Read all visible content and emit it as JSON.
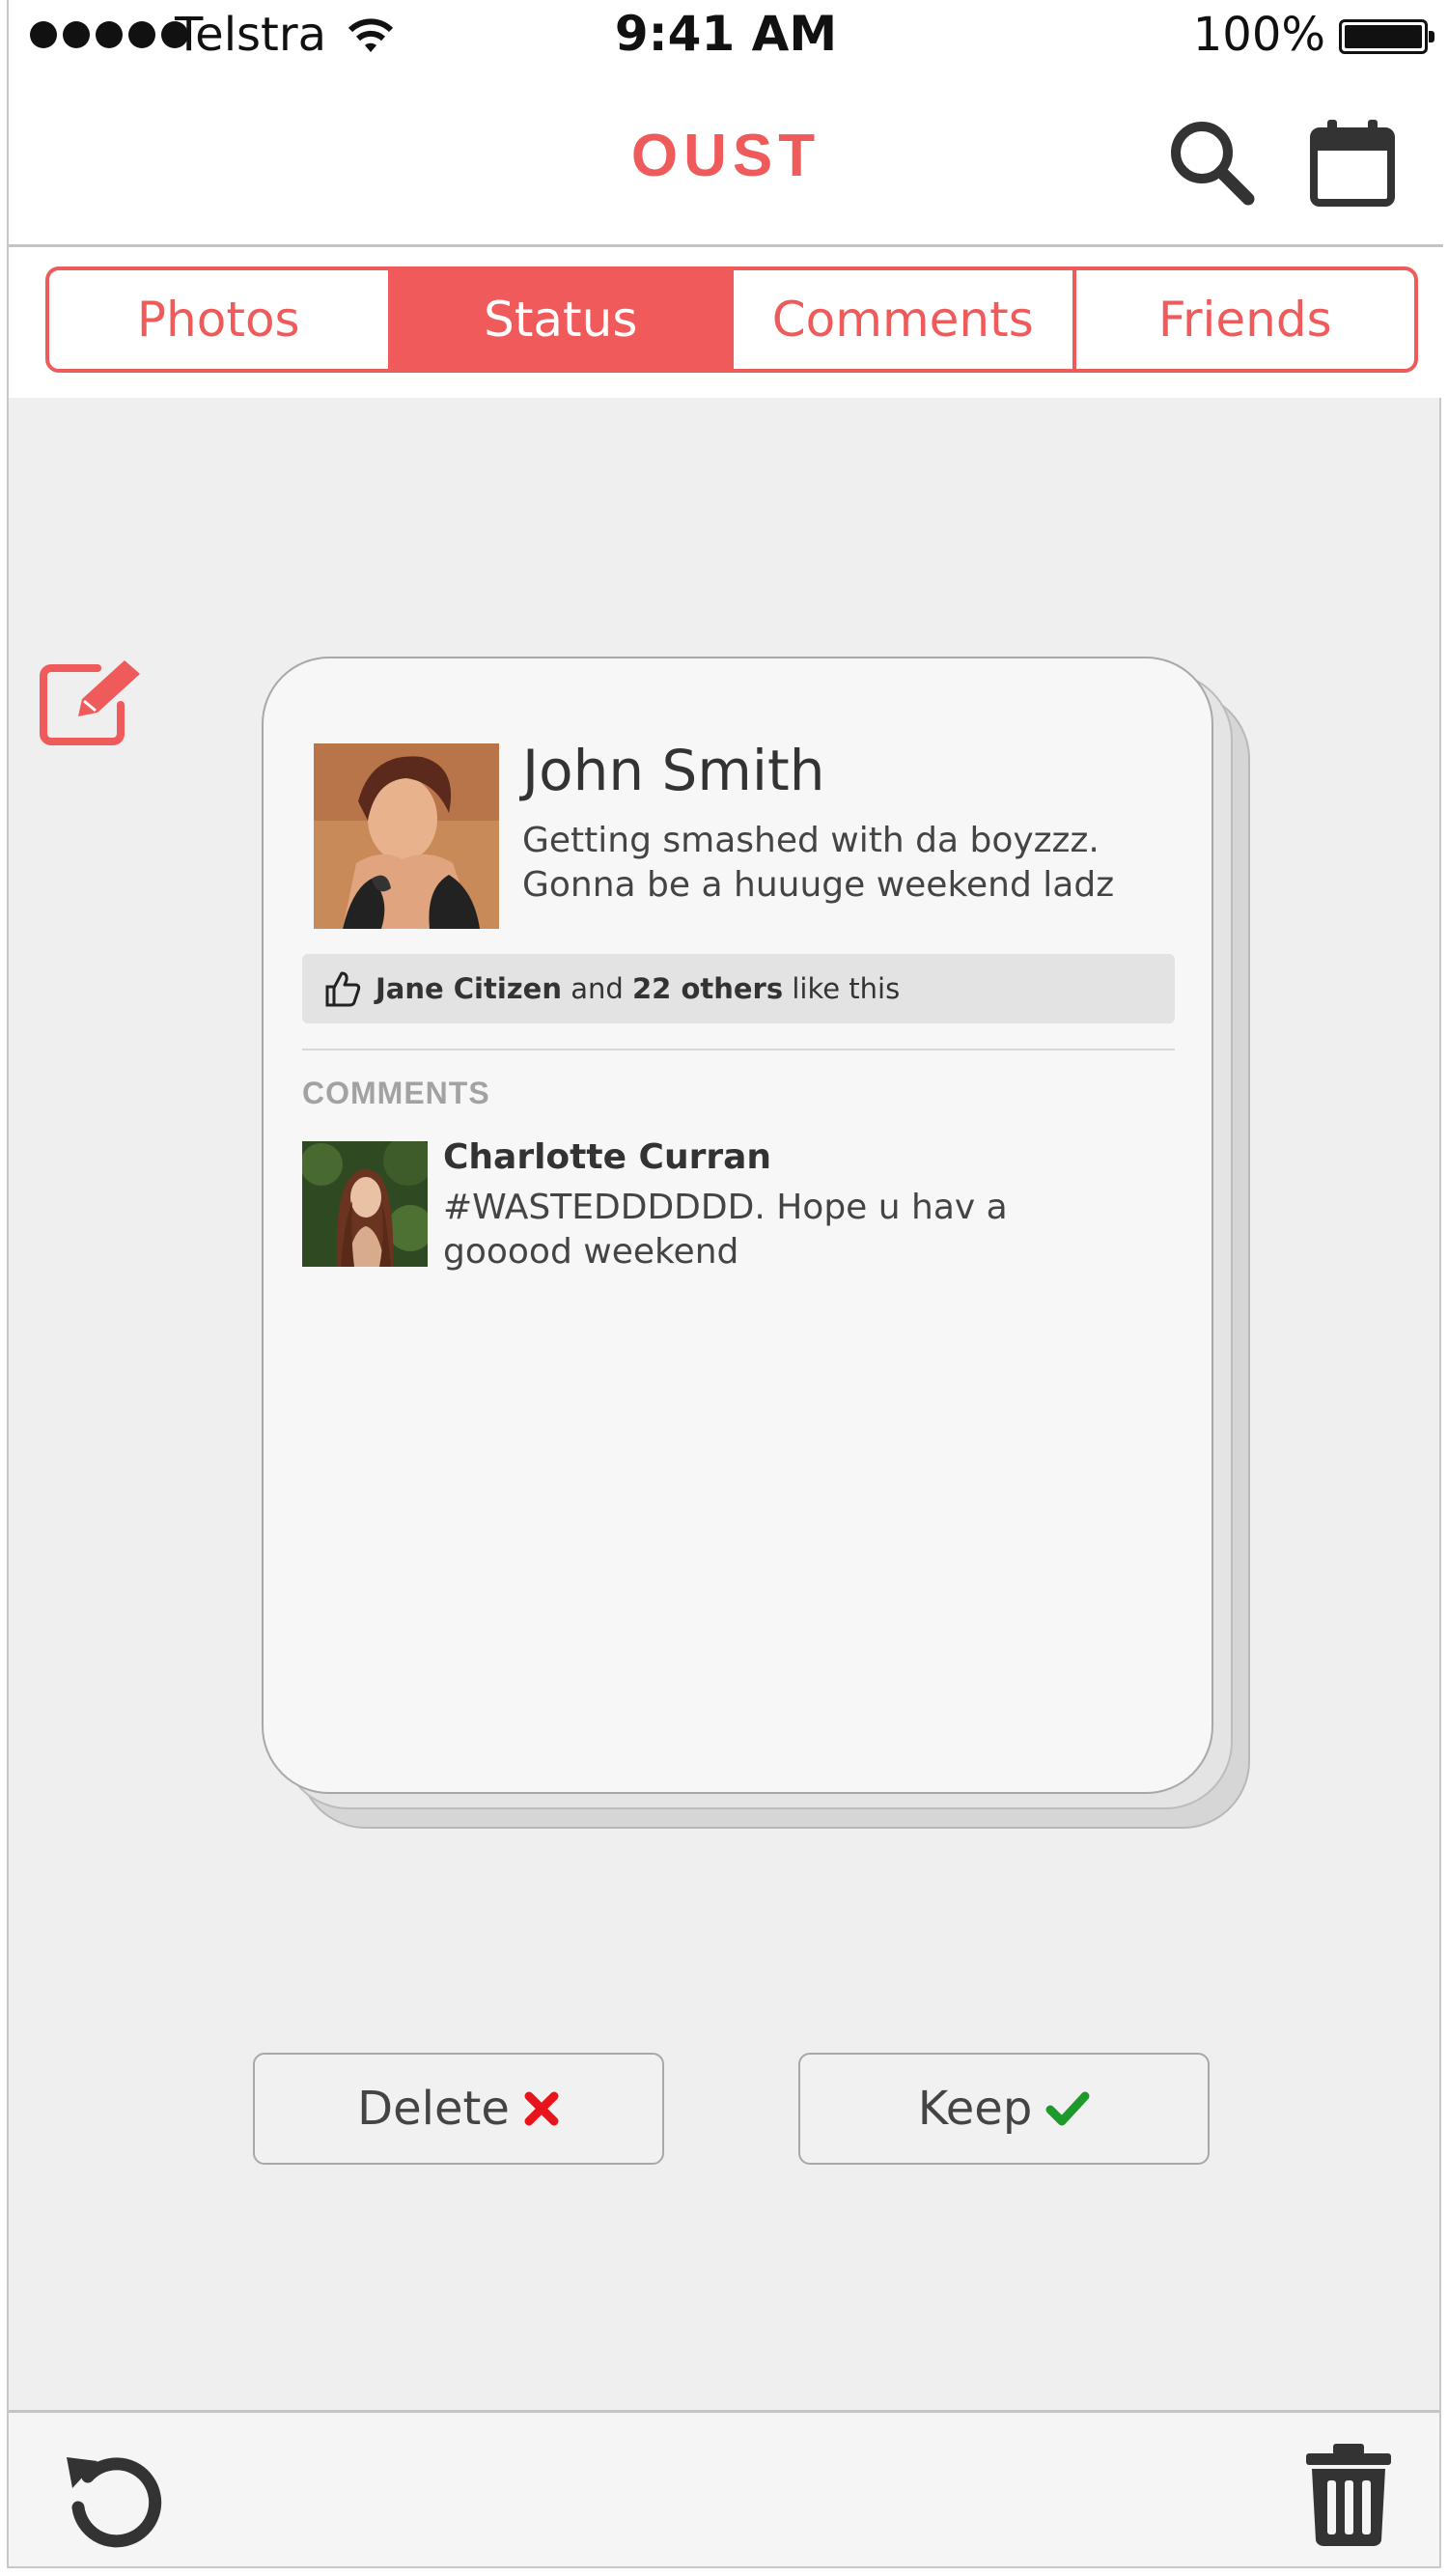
{
  "status_bar": {
    "carrier": "Telstra",
    "time": "9:41 AM",
    "battery": "100%",
    "signal_bars": 5
  },
  "nav": {
    "title": "OUST",
    "icons": [
      "search-icon",
      "calendar-icon"
    ]
  },
  "tabs": [
    {
      "label": "Photos",
      "active": false
    },
    {
      "label": "Status",
      "active": true
    },
    {
      "label": "Comments",
      "active": false
    },
    {
      "label": "Friends",
      "active": false
    }
  ],
  "post": {
    "author": "John Smith",
    "text": "Getting smashed with da boyzzz. Gonna be a huuuge weekend ladz",
    "likes": {
      "name": "Jane Citizen",
      "and": "and",
      "count": "22 others",
      "suffix": "like this"
    },
    "comments_heading": "COMMENTS",
    "comments": [
      {
        "author": "Charlotte Curran",
        "text": "#WASTEDDDDDD. Hope u hav a gooood weekend"
      }
    ]
  },
  "actions": {
    "delete_label": "Delete",
    "keep_label": "Keep"
  },
  "colors": {
    "accent": "#ef5a5a",
    "delete": "#e8141c",
    "keep": "#1e9a2a",
    "icon": "#333333"
  },
  "toolbar": {
    "icons": [
      "undo-icon",
      "trash-icon"
    ]
  }
}
